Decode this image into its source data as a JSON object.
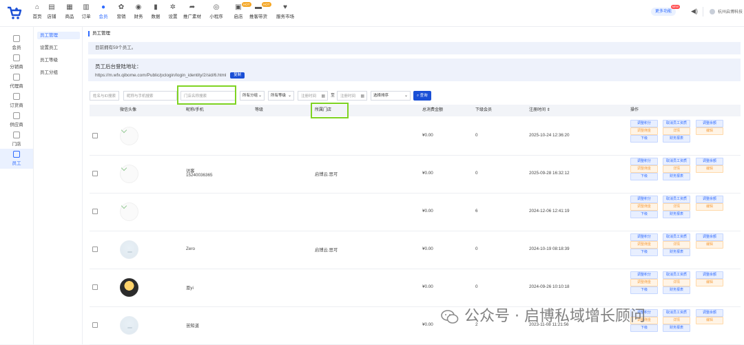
{
  "topnav": [
    {
      "label": "首页",
      "icon": "home-icon",
      "glyph": "⌂"
    },
    {
      "label": "店铺",
      "icon": "store-icon",
      "glyph": "▤"
    },
    {
      "label": "商品",
      "icon": "goods-icon",
      "glyph": "▦"
    },
    {
      "label": "订单",
      "icon": "order-icon",
      "glyph": "▥"
    },
    {
      "label": "会员",
      "icon": "member-icon",
      "glyph": "●",
      "active": true
    },
    {
      "label": "营销",
      "icon": "marketing-icon",
      "glyph": "✿"
    },
    {
      "label": "财务",
      "icon": "finance-icon",
      "glyph": "◉"
    },
    {
      "label": "数据",
      "icon": "data-icon",
      "glyph": "▮"
    },
    {
      "label": "设置",
      "icon": "settings-icon",
      "glyph": "✲"
    },
    {
      "label": "推广素材",
      "icon": "share-icon",
      "glyph": "➦"
    },
    {
      "label": "小程序",
      "icon": "miniprogram-icon",
      "glyph": "◎"
    },
    {
      "label": "启店",
      "icon": "shop-open-icon",
      "glyph": "▣",
      "badge": "HOT"
    },
    {
      "label": "推客带货",
      "icon": "promoter-icon",
      "glyph": "▬",
      "badge": "HOT"
    },
    {
      "label": "服务市场",
      "icon": "market-icon",
      "glyph": "♥"
    }
  ],
  "more_functions": {
    "label": "更多功能",
    "badge": "NEW"
  },
  "user": {
    "name": "杭州启博科技"
  },
  "leftnav": [
    {
      "label": "会员",
      "icon": "member-icon"
    },
    {
      "label": "分销商",
      "icon": "distributor-icon"
    },
    {
      "label": "代理商",
      "icon": "agent-icon"
    },
    {
      "label": "订货商",
      "icon": "buyer-icon"
    },
    {
      "label": "供应商",
      "icon": "supplier-icon"
    },
    {
      "label": "门店",
      "icon": "store-icon"
    },
    {
      "label": "员工",
      "icon": "staff-icon",
      "active": true
    }
  ],
  "subnav": [
    {
      "label": "员工管理",
      "active": true
    },
    {
      "label": "设置员工"
    },
    {
      "label": "员工等级"
    },
    {
      "label": "员工分组"
    }
  ],
  "page": {
    "title": "员工管理",
    "info": "目前拥有59个员工。",
    "url_title": "员工后台登陆地址：",
    "url": "https://m.wfx.qibome.com/Public/pclogin/login_identity/2/sid/6.html",
    "copy_label": "复制"
  },
  "filters": {
    "id_placeholder": "姓名与ID搜索",
    "nickname_placeholder": "昵称与手机搜索",
    "store_placeholder": "门店名称搜索",
    "group_select": "所有分组",
    "level_select": "所有等级",
    "start_time": "注册时间",
    "range_sep": "至",
    "end_time": "注册时间",
    "sort_select": "选择排序",
    "query_label": "查询"
  },
  "table": {
    "columns": [
      "微信头像",
      "昵称/手机",
      "等级",
      "所属门店",
      "总消费金额",
      "下级会员",
      "注册时间 ⇕",
      "操作"
    ],
    "op_labels": [
      "调整积分",
      "取消员工资质",
      "调整余额",
      "调整佣金",
      "详情",
      "编辑",
      "下级",
      "财务报表"
    ],
    "rows": [
      {
        "avatar": "broken",
        "name": "",
        "phone": "",
        "level": "",
        "store": "",
        "total": "¥0.00",
        "subs": "0",
        "reg": "2025-10-24 12:36:20"
      },
      {
        "avatar": "broken",
        "name": "访客",
        "phone": "15240036365",
        "level": "",
        "store": "启博云.思可",
        "total": "¥0.00",
        "subs": "0",
        "reg": "2025-09-28 16:32:12"
      },
      {
        "avatar": "broken",
        "name": "",
        "phone": "",
        "level": "",
        "store": "",
        "total": "¥0.00",
        "subs": "6",
        "reg": "2024-12-06 12:41:19"
      },
      {
        "avatar": "pastel",
        "name": "Zero",
        "phone": "",
        "level": "",
        "store": "启博云.思可",
        "total": "¥0.00",
        "subs": "0",
        "reg": "2024-10-19 08:18:39"
      },
      {
        "avatar": "photo",
        "name": "恩yi",
        "phone": "",
        "level": "",
        "store": "",
        "total": "¥0.00",
        "subs": "0",
        "reg": "2024-09-26 10:10:18"
      },
      {
        "avatar": "pastel",
        "name": "苦知道",
        "phone": "",
        "level": "",
        "store": "",
        "total": "¥0.00",
        "subs": "2",
        "reg": "2023-11-08 11:21:56"
      }
    ]
  },
  "watermark": "公众号 · 启博私域增长顾问"
}
